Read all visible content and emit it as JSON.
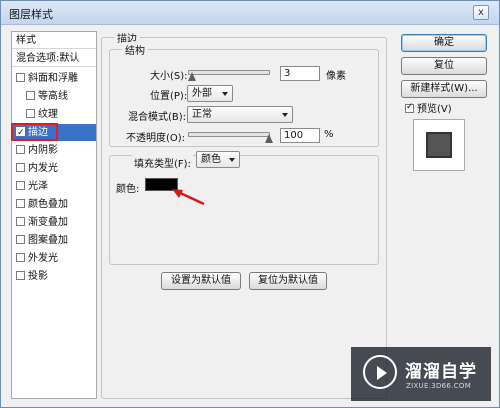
{
  "window": {
    "title": "图层样式",
    "close": "x"
  },
  "left_list": {
    "header": "样式",
    "blend_options": "混合选项:默认",
    "items": [
      {
        "label": "斜面和浮雕",
        "checked": false
      },
      {
        "label": "等高线",
        "checked": false
      },
      {
        "label": "纹理",
        "checked": false
      },
      {
        "label": "描边",
        "checked": true
      },
      {
        "label": "内阴影",
        "checked": false
      },
      {
        "label": "内发光",
        "checked": false
      },
      {
        "label": "光泽",
        "checked": false
      },
      {
        "label": "颜色叠加",
        "checked": false
      },
      {
        "label": "渐变叠加",
        "checked": false
      },
      {
        "label": "图案叠加",
        "checked": false
      },
      {
        "label": "外发光",
        "checked": false
      },
      {
        "label": "投影",
        "checked": false
      }
    ],
    "selected": "描边"
  },
  "stroke": {
    "group_title": "描边",
    "structure_title": "结构",
    "size_label": "大小(S):",
    "size_value": "3",
    "size_unit": "像素",
    "position_label": "位置(P):",
    "position_value": "外部",
    "blend_label": "混合模式(B):",
    "blend_value": "正常",
    "opacity_label": "不透明度(O):",
    "opacity_value": "100",
    "opacity_unit": "%",
    "fill_type_label": "填充类型(F):",
    "fill_type_value": "颜色",
    "color_label": "颜色:",
    "color_hex": "#000000",
    "size_fraction": 0.02,
    "opacity_fraction": 1.0
  },
  "buttons": {
    "ok": "确定",
    "reset": "复位",
    "new_style": "新建样式(W)...",
    "preview": "预览(V)",
    "set_default": "设置为默认值",
    "reset_default": "复位为默认值"
  },
  "watermark": {
    "title": "溜溜自学",
    "subtitle": "ZIXUE.3D66.COM"
  },
  "colors": {
    "selection": "#3a72c7",
    "highlight_box": "#e11d1d",
    "arrow": "#d11a1a"
  }
}
